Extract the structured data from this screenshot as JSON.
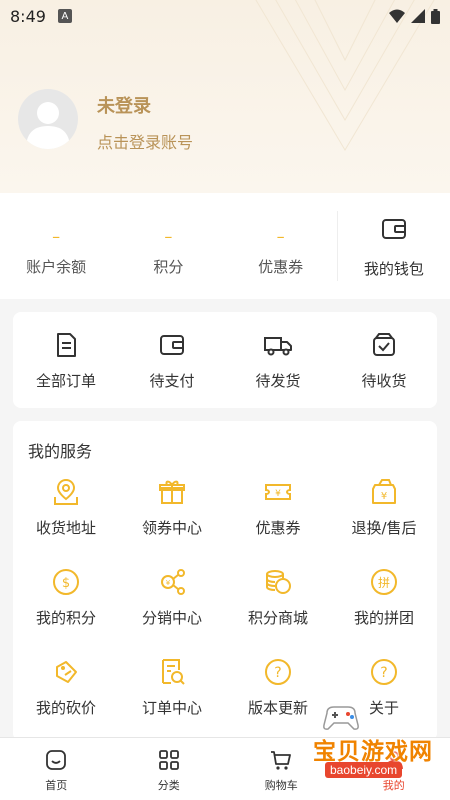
{
  "status_bar": {
    "time": "8:49",
    "notification_letter": "A"
  },
  "user": {
    "title": "未登录",
    "subtitle": "点击登录账号"
  },
  "account": {
    "items": [
      {
        "value": "–",
        "label": "账户余额"
      },
      {
        "value": "–",
        "label": "积分"
      },
      {
        "value": "–",
        "label": "优惠券"
      }
    ],
    "wallet": {
      "label": "我的钱包",
      "icon": "wallet-icon"
    }
  },
  "orders": [
    {
      "label": "全部订单",
      "icon": "document-icon"
    },
    {
      "label": "待支付",
      "icon": "wallet-icon"
    },
    {
      "label": "待发货",
      "icon": "truck-icon"
    },
    {
      "label": "待收货",
      "icon": "box-check-icon"
    }
  ],
  "services": {
    "title": "我的服务",
    "items": [
      {
        "label": "收货地址",
        "icon": "map-pin-icon"
      },
      {
        "label": "领券中心",
        "icon": "gift-icon"
      },
      {
        "label": "优惠券",
        "icon": "ticket-icon"
      },
      {
        "label": "退换/售后",
        "icon": "yen-wallet-icon"
      },
      {
        "label": "我的积分",
        "icon": "dollar-coin-icon"
      },
      {
        "label": "分销中心",
        "icon": "share-network-icon"
      },
      {
        "label": "积分商城",
        "icon": "coin-stack-icon"
      },
      {
        "label": "我的拼团",
        "icon": "group-buy-icon"
      },
      {
        "label": "我的砍价",
        "icon": "price-tag-icon"
      },
      {
        "label": "订单中心",
        "icon": "order-search-icon"
      },
      {
        "label": "版本更新",
        "icon": "question-icon"
      },
      {
        "label": "关于",
        "icon": "question-icon"
      }
    ]
  },
  "nav": [
    {
      "label": "首页",
      "icon": "home-icon"
    },
    {
      "label": "分类",
      "icon": "grid-icon"
    },
    {
      "label": "购物车",
      "icon": "cart-icon"
    },
    {
      "label": "我的",
      "icon": "user-icon"
    }
  ],
  "watermark": {
    "text": "宝贝游戏网",
    "url": "baobeiy.com"
  },
  "colors": {
    "accent": "#f2b82b",
    "gold_text": "#b99358",
    "header_bg": "#f8f0e3"
  }
}
